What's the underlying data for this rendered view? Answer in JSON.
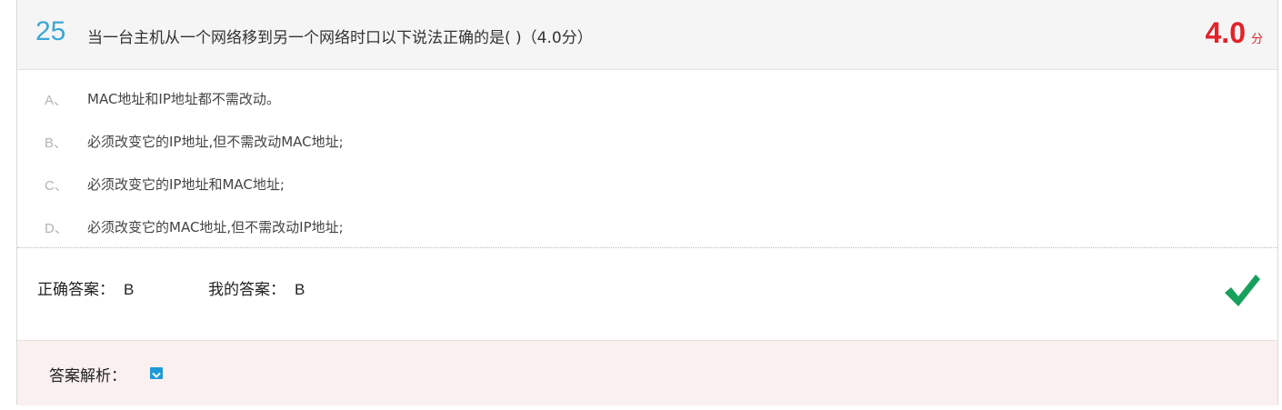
{
  "question": {
    "number": "25",
    "text": "当一台主机从一个网络移到另一个网络时口以下说法正确的是( )（4.0分）",
    "score": "4.0",
    "score_unit": "分"
  },
  "options": [
    {
      "letter": "A、",
      "text": "MAC地址和IP地址都不需改动。"
    },
    {
      "letter": "B、",
      "text": "必须改变它的IP地址,但不需改动MAC地址;"
    },
    {
      "letter": "C、",
      "text": "必须改变它的IP地址和MAC地址;"
    },
    {
      "letter": "D、",
      "text": "必须改变它的MAC地址,但不需改动IP地址;"
    }
  ],
  "answer": {
    "correct_label": "正确答案：",
    "correct_value": "B",
    "mine_label": "我的答案：",
    "mine_value": "B",
    "status_icon": "checkmark-icon"
  },
  "analysis": {
    "label": "答案解析：",
    "toggle_icon": "chevron-down-icon"
  },
  "colors": {
    "accent": "#3aa7d8",
    "score": "#e0242b",
    "check": "#17a05d",
    "analysis_bg": "#fbf0f0"
  }
}
